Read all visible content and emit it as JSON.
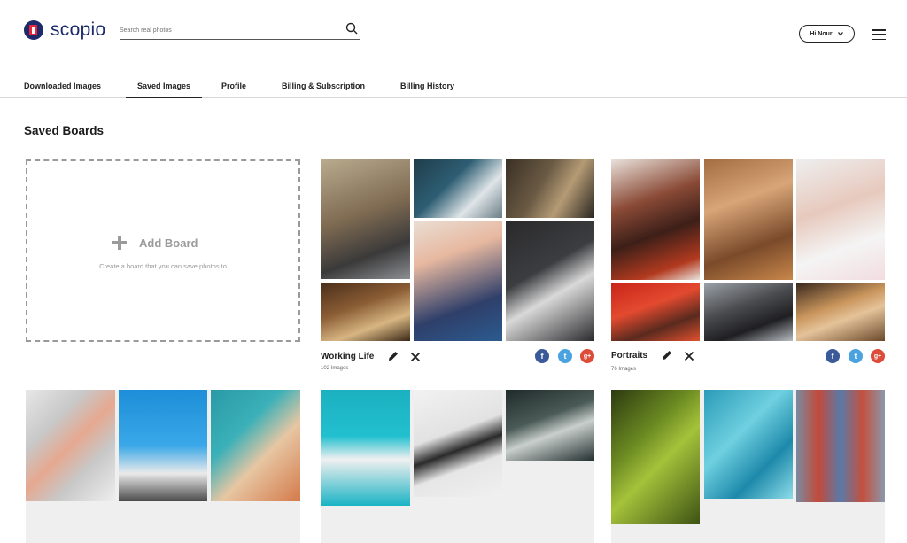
{
  "brand": {
    "name": "scopio"
  },
  "search": {
    "placeholder": "Search real photos"
  },
  "user": {
    "greeting": "Hi Nour"
  },
  "tabs": [
    {
      "label": "Downloaded Images"
    },
    {
      "label": "Saved Images"
    },
    {
      "label": "Profile"
    },
    {
      "label": "Billing & Subscription"
    },
    {
      "label": "Billing History"
    }
  ],
  "section": {
    "title": "Saved Boards"
  },
  "add_board": {
    "label": "Add Board",
    "description": "Create a board that you can save photos to"
  },
  "boards": [
    {
      "name": "Working Life",
      "count": "102 Images"
    },
    {
      "name": "Portraits",
      "count": "76 Images"
    }
  ],
  "social": {
    "facebook": "f",
    "twitter": "t",
    "google": "g+"
  },
  "colors": {
    "brand_navy": "#1d2a6b",
    "brand_red": "#e8253a",
    "facebook": "#3b5a98",
    "twitter": "#4aa3df",
    "google": "#dd4b39"
  }
}
